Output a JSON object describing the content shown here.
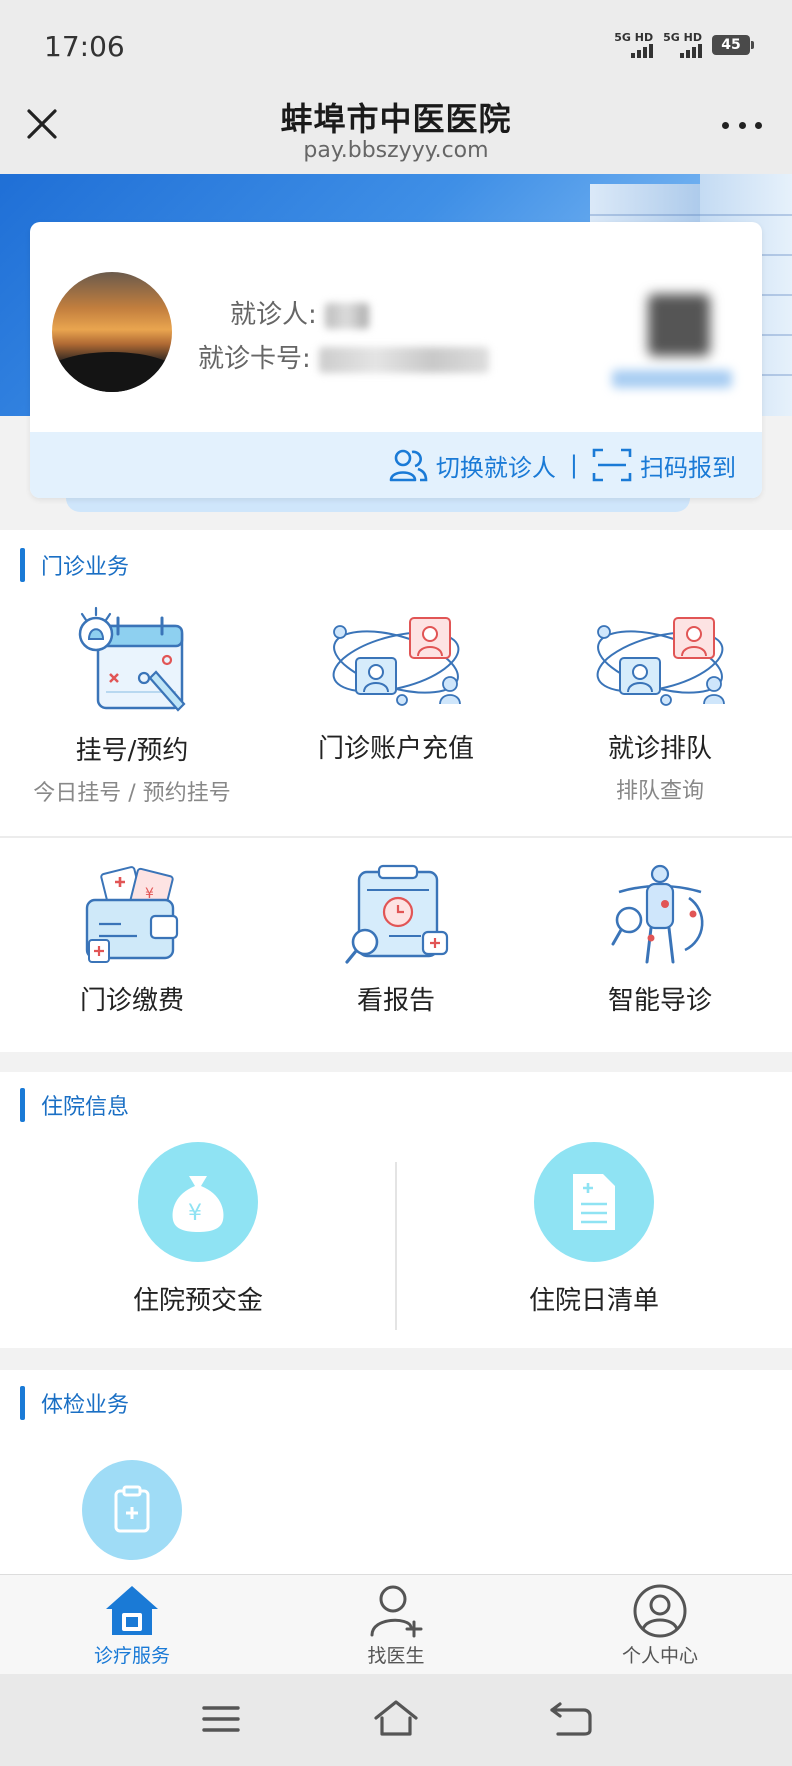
{
  "status_bar": {
    "time": "17:06",
    "signal1": "5G HD",
    "signal2": "5G HD",
    "battery": "45"
  },
  "header": {
    "title": "蚌埠市中医医院",
    "url": "pay.bbszyyy.com"
  },
  "patient": {
    "name_label": "就诊人:",
    "card_label": "就诊卡号:",
    "switch_label": "切换就诊人",
    "separator": "|",
    "scan_label": "扫码报到"
  },
  "outpatient": {
    "title": "门诊业务",
    "tiles": [
      {
        "label": "挂号/预约",
        "sub": "今日挂号 / 预约挂号",
        "icon": "calendar-icon"
      },
      {
        "label": "门诊账户充值",
        "sub": "",
        "icon": "doctor-network-icon"
      },
      {
        "label": "就诊排队",
        "sub": "排队查询",
        "icon": "doctor-network-icon"
      },
      {
        "label": "门诊缴费",
        "sub": "",
        "icon": "wallet-icon"
      },
      {
        "label": "看报告",
        "sub": "",
        "icon": "report-clipboard-icon"
      },
      {
        "label": "智能导诊",
        "sub": "",
        "icon": "body-guide-icon"
      }
    ]
  },
  "inpatient": {
    "title": "住院信息",
    "tiles": [
      {
        "label": "住院预交金",
        "icon": "money-bag-icon"
      },
      {
        "label": "住院日清单",
        "icon": "document-icon"
      }
    ]
  },
  "checkup": {
    "title": "体检业务",
    "tiles": [
      {
        "label": "",
        "icon": "medical-clipboard-icon"
      }
    ]
  },
  "bottom_nav": [
    {
      "label": "诊疗服务",
      "icon": "home-icon",
      "active": true
    },
    {
      "label": "找医生",
      "icon": "add-user-icon",
      "active": false
    },
    {
      "label": "个人中心",
      "icon": "profile-icon",
      "active": false
    }
  ],
  "colors": {
    "accent": "#1a7ad6",
    "light_blue": "#e3f1fd",
    "icon_cyan": "#8fe3f3"
  }
}
